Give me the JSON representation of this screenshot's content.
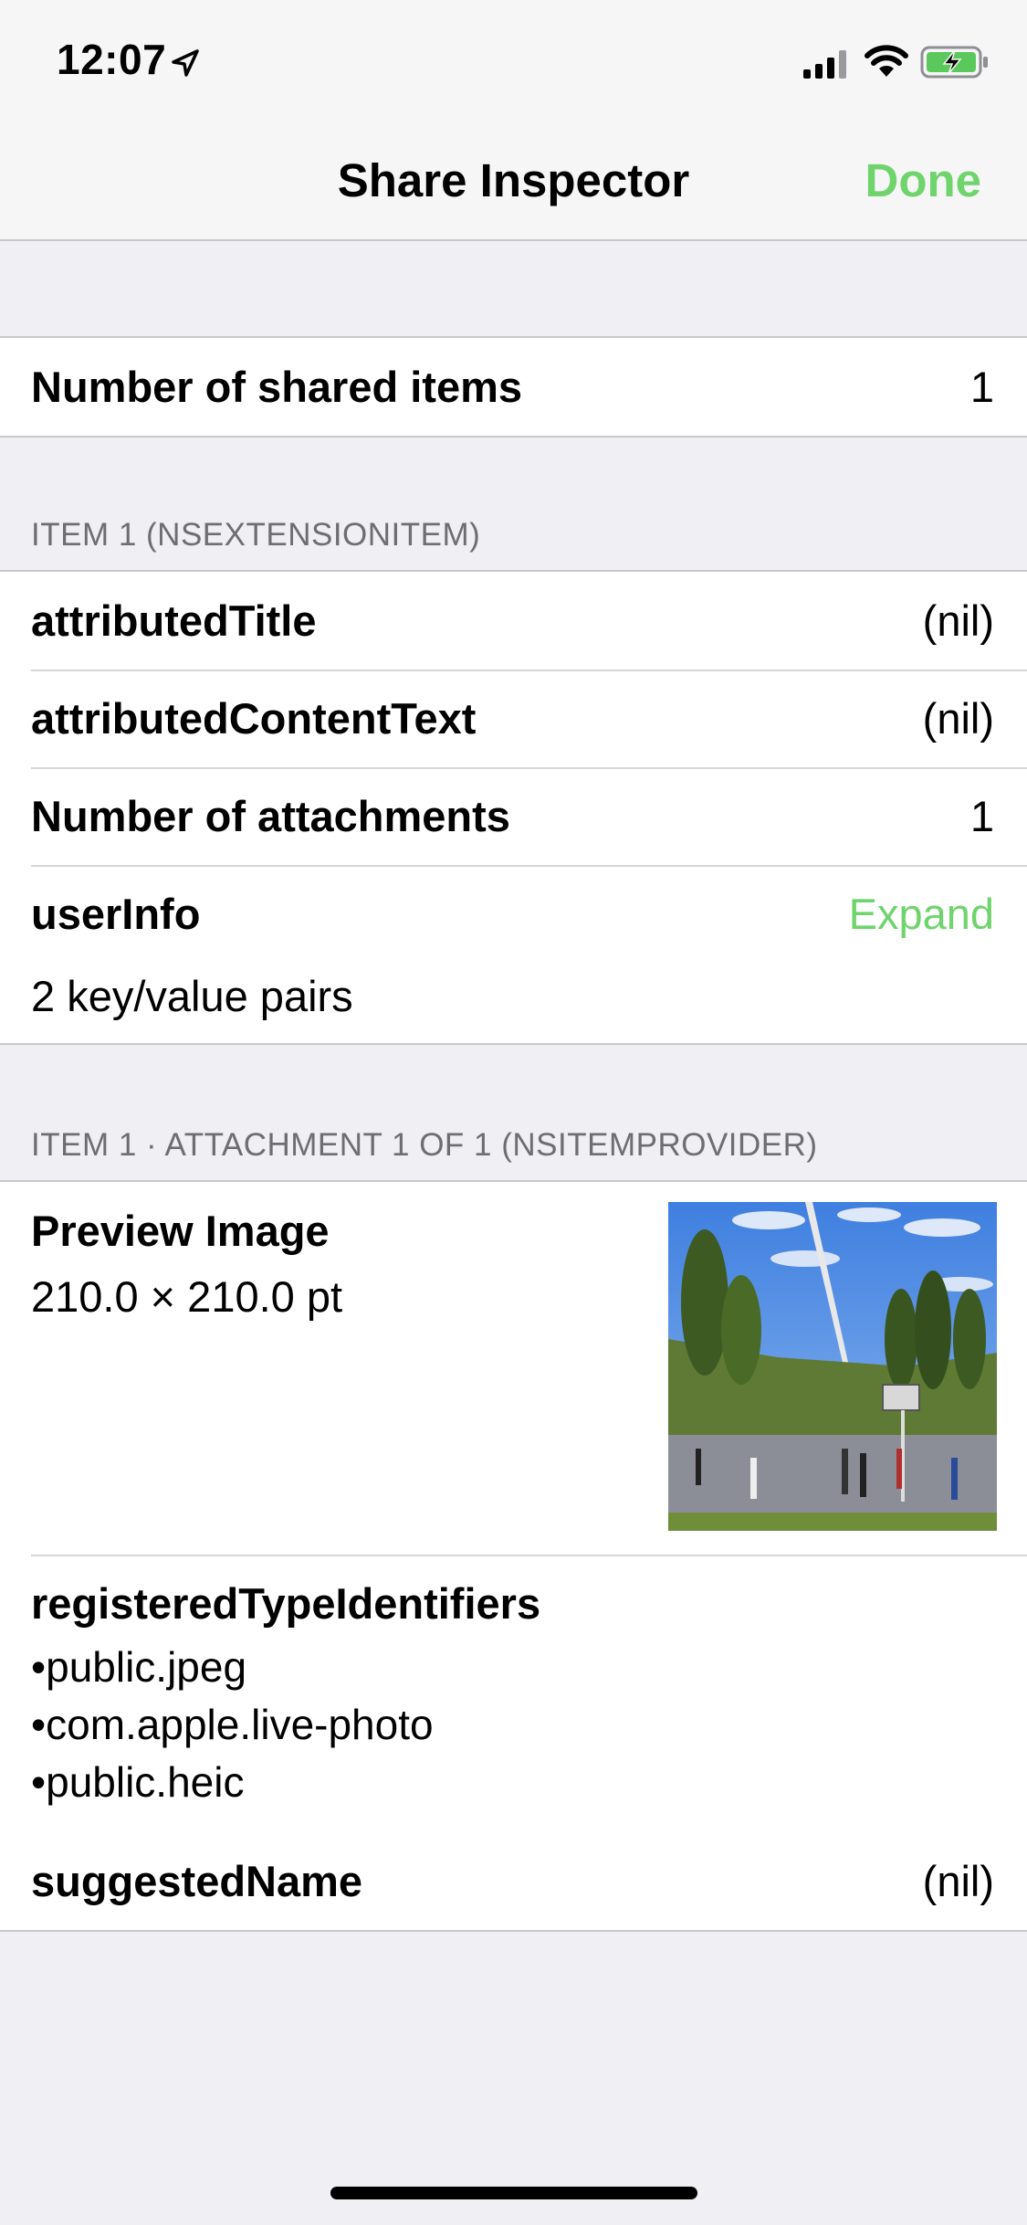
{
  "status_bar": {
    "time": "12:07",
    "icons": [
      "location-arrow-icon",
      "cellular-signal-icon",
      "wifi-icon",
      "battery-charging-icon"
    ]
  },
  "nav": {
    "title": "Share Inspector",
    "done_label": "Done",
    "accent_color": "#6fd46c"
  },
  "summary": {
    "shared_items_label": "Number of shared items",
    "shared_items_value": "1"
  },
  "item": {
    "header": "ITEM 1 (NSEXTENSIONITEM)",
    "rows": [
      {
        "label": "attributedTitle",
        "value": "(nil)"
      },
      {
        "label": "attributedContentText",
        "value": "(nil)"
      },
      {
        "label": "Number of attachments",
        "value": "1"
      }
    ],
    "user_info": {
      "label": "userInfo",
      "action": "Expand",
      "detail": "2 key/value pairs"
    }
  },
  "attachment": {
    "header": "ITEM 1 · ATTACHMENT 1 OF 1 (NSITEMPROVIDER)",
    "preview": {
      "label": "Preview Image",
      "size": "210.0 × 210.0 pt"
    },
    "type_identifiers": {
      "label": "registeredTypeIdentifiers",
      "items": [
        "public.jpeg",
        "com.apple.live-photo",
        "public.heic"
      ]
    },
    "suggested_name": {
      "label": "suggestedName",
      "value": "(nil)"
    }
  }
}
